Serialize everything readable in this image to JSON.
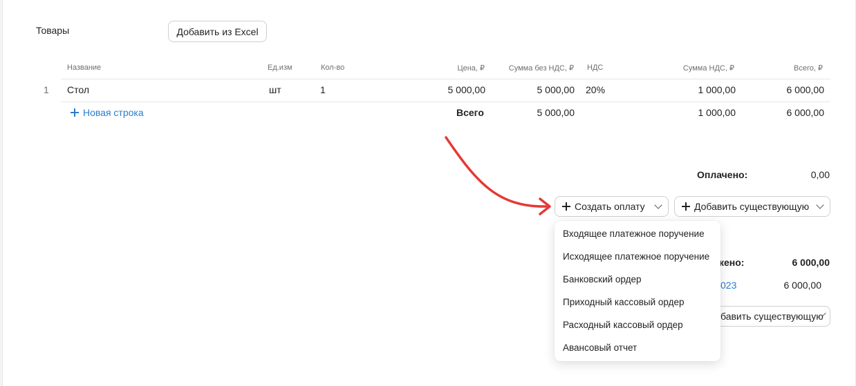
{
  "section": {
    "title": "Товары",
    "add_from_excel": "Добавить из Excel"
  },
  "table": {
    "headers": {
      "name": "Название",
      "unit": "Ед.изм",
      "qty": "Кол-во",
      "price": "Цена, ₽",
      "sum_no_vat": "Сумма без НДС, ₽",
      "vat": "НДС",
      "vat_sum": "Сумма НДС, ₽",
      "total": "Всего, ₽"
    },
    "rows": [
      {
        "index": "1",
        "name": "Стол",
        "unit": "шт",
        "qty": "1",
        "price": "5 000,00",
        "sum_no_vat": "5 000,00",
        "vat": "20%",
        "vat_sum": "1 000,00",
        "total": "6 000,00"
      }
    ],
    "new_row_label": "Новая строка",
    "totals": {
      "label": "Всего",
      "sum_no_vat": "5 000,00",
      "vat_sum": "1 000,00",
      "total": "6 000,00"
    }
  },
  "payments": {
    "paid_label": "Оплачено:",
    "paid_value": "0,00",
    "create_payment_label": "Создать оплату",
    "add_existing_label": "Добавить существующую",
    "shipped_label_partial": "кено:",
    "shipped_value": "6 000,00",
    "doc_link_partial": "023",
    "doc_amount": "6 000,00",
    "add_existing_partial": "бавить существующую"
  },
  "menu": {
    "items": [
      "Входящее платежное поручение",
      "Исходящее платежное поручение",
      "Банковский ордер",
      "Приходный кассовый ордер",
      "Расходный кассовый ордер",
      "Авансовый отчет"
    ]
  },
  "colors": {
    "link": "#2a7bd0",
    "arrow": "#e53935",
    "border": "#cfcfcf"
  },
  "icons": {
    "plus": "plus-icon",
    "chevron": "chevron-down-icon"
  }
}
